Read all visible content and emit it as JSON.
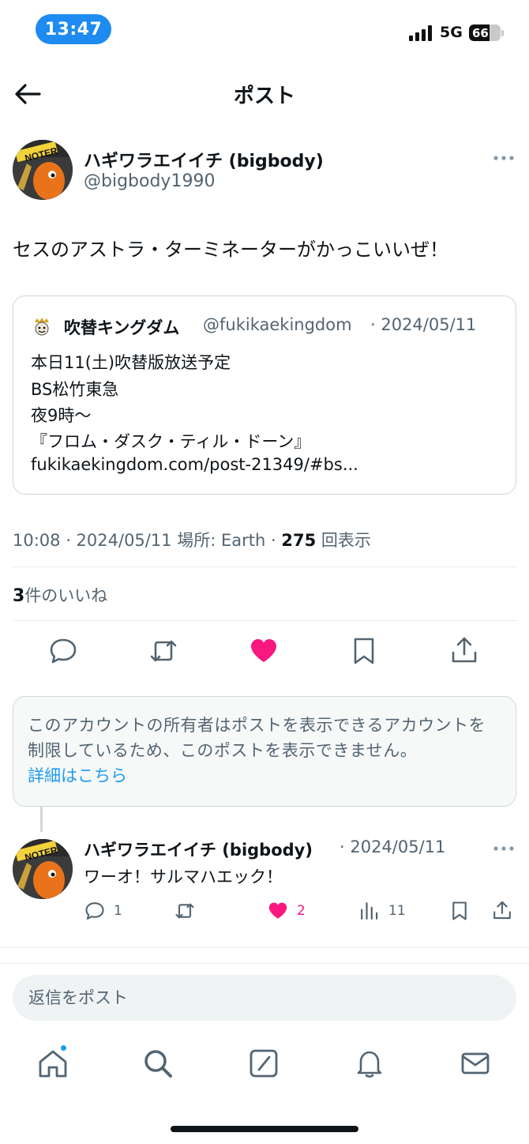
{
  "status_bar": {
    "time": "13:47",
    "network": "5G",
    "battery": "66",
    "battery_level": 0.66
  },
  "header": {
    "title": "ポスト"
  },
  "post": {
    "author_name": "ハギワラエイイチ (bigbody)",
    "author_handle": "@bigbody1990",
    "avatar_text": "NOTER",
    "text": "セスのアストラ・ターミネーターがかっこいいぜ！",
    "quote": {
      "name": "吹替キングダム",
      "handle": "@fukikaekingdom",
      "date": "· 2024/05/11",
      "lines": [
        "本日11(土)吹替版放送予定",
        "BS松竹東急",
        "夜9時〜",
        "『フロム・ダスク・ティル・ドーン』",
        "fukikaekingdom.com/post-21349/#bs..."
      ]
    },
    "meta": {
      "time_date_location": "10:08 · 2024/05/11 場所: Earth ·",
      "views_count": "275",
      "views_label": "回表示"
    },
    "likes": {
      "count": "3",
      "label": "件のいいね"
    }
  },
  "notice": {
    "text": "このアカウントの所有者はポストを表示できるアカウントを制限しているため、このポストを表示できません。",
    "link": "詳細はこちら"
  },
  "reply": {
    "author_name": "ハギワラエイイチ (bigbody)",
    "date": "· 2024/05/11",
    "text": "ワーオ！サルマハエック！",
    "reply_count": "1",
    "like_count": "2",
    "view_count": "11"
  },
  "compose": {
    "placeholder": "返信をポスト"
  },
  "colors": {
    "accent": "#1d9bf0",
    "like": "#f91880",
    "text": "#0f1419",
    "secondary": "#536471"
  }
}
